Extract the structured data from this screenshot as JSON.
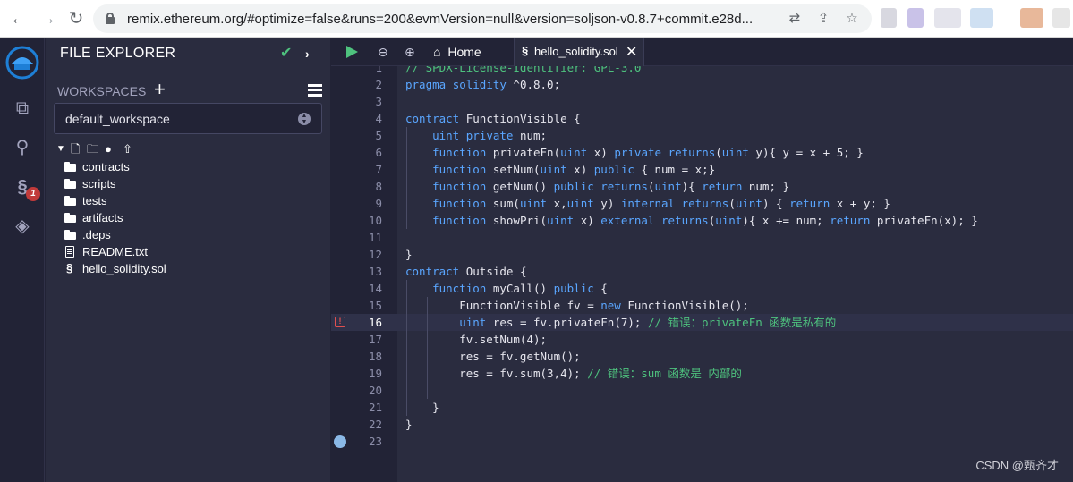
{
  "browser": {
    "url": "remix.ethereum.org/#optimize=false&runs=200&evmVersion=null&version=soljson-v0.8.7+commit.e28d...",
    "back_icon": "arrow-left-icon",
    "forward_icon": "arrow-right-icon",
    "reload_icon": "reload-icon"
  },
  "sidebar": {
    "title": "FILE EXPLORER",
    "workspaces_label": "WORKSPACES",
    "workspace_value": "default_workspace",
    "plugin_badge": "1",
    "accent": "#4ec27e"
  },
  "tree": [
    {
      "name": "contracts",
      "kind": "folder"
    },
    {
      "name": "scripts",
      "kind": "folder"
    },
    {
      "name": "tests",
      "kind": "folder"
    },
    {
      "name": "artifacts",
      "kind": "folder"
    },
    {
      "name": ".deps",
      "kind": "folder"
    },
    {
      "name": "README.txt",
      "kind": "file"
    },
    {
      "name": "hello_solidity.sol",
      "kind": "sol"
    }
  ],
  "tabs": {
    "home": "Home",
    "file": "hello_solidity.sol"
  },
  "editor": {
    "lines": [
      "// SPDX-License-Identifier: GPL-3.0",
      "pragma solidity ^0.8.0;",
      "",
      "contract FunctionVisible {",
      "    uint private num;",
      "    function privateFn(uint x) private returns(uint y){ y = x + 5; }",
      "    function setNum(uint x) public { num = x;}",
      "    function getNum() public returns(uint){ return num; }",
      "    function sum(uint x,uint y) internal returns(uint) { return x + y; }",
      "    function showPri(uint x) external returns(uint){ x += num; return privateFn(x); }",
      "",
      "}",
      "contract Outside {",
      "    function myCall() public {",
      "        FunctionVisible fv = new FunctionVisible();",
      "        uint res = fv.privateFn(7); // 错误：privateFn 函数是私有的",
      "        fv.setNum(4);",
      "        res = fv.getNum();",
      "        res = fv.sum(3,4); // 错误：sum 函数是 内部的",
      "",
      "    }",
      "}",
      ""
    ],
    "error_line": 16,
    "current_line": 16,
    "breakpoint_line": 23
  },
  "watermark": "CSDN @甄齐才"
}
